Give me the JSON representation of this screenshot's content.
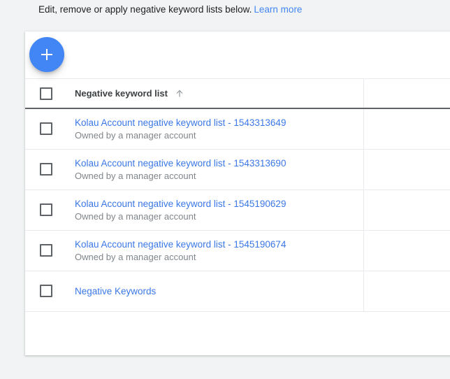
{
  "intro": {
    "text": "Edit, remove or apply negative keyword lists below.",
    "learn_more_label": "Learn more",
    "link_color": "#4285f4"
  },
  "toolbar": {
    "add_button": {
      "icon": "plus-icon",
      "aria_label": "Add negative keyword list",
      "color": "#4285f4"
    }
  },
  "table": {
    "columns": [
      {
        "key": "checkbox",
        "label": ""
      },
      {
        "key": "name",
        "label": "Negative keyword list"
      },
      {
        "key": "extra",
        "label": ""
      }
    ],
    "sort": {
      "column": "Negative keyword list",
      "direction": "ascending",
      "icon": "arrow-up-icon"
    },
    "select_all": {
      "checked": false
    },
    "rows": [
      {
        "checked": false,
        "name": "Kolau Account negative keyword list - 1543313649",
        "subtitle": "Owned by a manager account",
        "extra": ""
      },
      {
        "checked": false,
        "name": "Kolau Account negative keyword list - 1543313690",
        "subtitle": "Owned by a manager account",
        "extra": ""
      },
      {
        "checked": false,
        "name": "Kolau Account negative keyword list - 1545190629",
        "subtitle": "Owned by a manager account",
        "extra": ""
      },
      {
        "checked": false,
        "name": "Kolau Account negative keyword list - 1545190674",
        "subtitle": "Owned by a manager account",
        "extra": ""
      },
      {
        "checked": false,
        "name": "Negative Keywords",
        "subtitle": "",
        "extra": ""
      }
    ]
  },
  "colors": {
    "page_background": "#f1f3f4",
    "card_background": "#ffffff",
    "link": "#3b78e7",
    "subtitle": "#80868b",
    "header_text": "#3c4043",
    "divider": "#e8eaed",
    "header_rule": "#5f6368"
  }
}
